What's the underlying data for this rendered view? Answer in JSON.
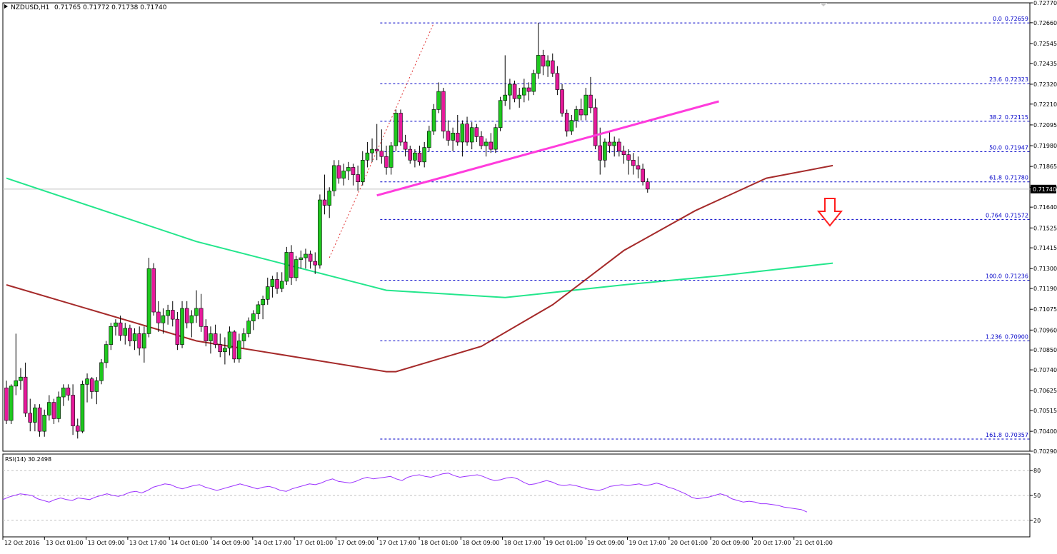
{
  "header": {
    "symbol": "NZDUSD,H1",
    "ohlc": "0.71765 0.71772 0.71738 0.71740"
  },
  "colors": {
    "bull": "#1ec81e",
    "bear": "#e6199b",
    "wick": "#000000",
    "sma_fast": "#a52a2a",
    "sma_slow": "#23e68c",
    "trendline": "#ff3cdc",
    "fib": "#0000c8",
    "arrow": "#ff1e1e",
    "rsi": "#9b30ff",
    "price_tag_bg": "#000000",
    "price_tag_text": "#ffffff"
  },
  "chart_data": [
    {
      "type": "candlestick",
      "title": "NZDUSD,H1",
      "ylim": [
        0.7029,
        0.7277
      ],
      "y_ticks": [
        "0.72770",
        "0.72660",
        "0.72545",
        "0.72435",
        "0.72320",
        "0.72210",
        "0.72095",
        "0.71980",
        "0.71865",
        "0.71750",
        "0.71640",
        "0.71525",
        "0.71415",
        "0.71300",
        "0.71190",
        "0.71075",
        "0.70960",
        "0.70850",
        "0.70740",
        "0.70625",
        "0.70515",
        "0.70400",
        "0.70290"
      ],
      "x_ticks": [
        "12 Oct 2016",
        "13 Oct 01:00",
        "13 Oct 09:00",
        "13 Oct 17:00",
        "14 Oct 01:00",
        "14 Oct 09:00",
        "14 Oct 17:00",
        "17 Oct 01:00",
        "17 Oct 09:00",
        "17 Oct 17:00",
        "18 Oct 01:00",
        "18 Oct 09:00",
        "18 Oct 17:00",
        "19 Oct 01:00",
        "19 Oct 09:00",
        "19 Oct 17:00",
        "20 Oct 01:00",
        "20 Oct 09:00",
        "20 Oct 17:00",
        "21 Oct 01:00"
      ],
      "current_price": "0.71740",
      "fibonacci_levels": [
        {
          "label": "0.0",
          "price": "0.72659"
        },
        {
          "label": "23.6",
          "price": "0.72323"
        },
        {
          "label": "38.2",
          "price": "0.72115"
        },
        {
          "label": "50.0",
          "price": "0.71947"
        },
        {
          "label": "61.8",
          "price": "0.71780"
        },
        {
          "label": "0.764",
          "price": "0.71572"
        },
        {
          "label": "100.0",
          "price": "0.71236"
        },
        {
          "label": "1.236",
          "price": "0.70900"
        },
        {
          "label": "161.8",
          "price": "0.70357"
        }
      ],
      "candles": [
        [
          0.7064,
          0.7068,
          0.7044,
          0.7046
        ],
        [
          0.7046,
          0.7066,
          0.7044,
          0.7065
        ],
        [
          0.7065,
          0.7094,
          0.706,
          0.7068
        ],
        [
          0.7068,
          0.7075,
          0.7063,
          0.707
        ],
        [
          0.707,
          0.7078,
          0.7048,
          0.705
        ],
        [
          0.705,
          0.7058,
          0.704,
          0.7045
        ],
        [
          0.7045,
          0.7055,
          0.704,
          0.7053
        ],
        [
          0.7053,
          0.7055,
          0.7037,
          0.704
        ],
        [
          0.704,
          0.7052,
          0.7037,
          0.7049
        ],
        [
          0.7049,
          0.706,
          0.7046,
          0.7056
        ],
        [
          0.7056,
          0.7058,
          0.7044,
          0.7047
        ],
        [
          0.7047,
          0.7062,
          0.7045,
          0.7059
        ],
        [
          0.7059,
          0.7066,
          0.7054,
          0.7064
        ],
        [
          0.7064,
          0.7066,
          0.7057,
          0.706
        ],
        [
          0.706,
          0.7066,
          0.7038,
          0.7043
        ],
        [
          0.7043,
          0.7047,
          0.7036,
          0.704
        ],
        [
          0.704,
          0.7068,
          0.7039,
          0.7066
        ],
        [
          0.7066,
          0.7072,
          0.7056,
          0.7069
        ],
        [
          0.7069,
          0.707,
          0.7058,
          0.7062
        ],
        [
          0.7062,
          0.707,
          0.7055,
          0.7068
        ],
        [
          0.7068,
          0.708,
          0.7066,
          0.7078
        ],
        [
          0.7078,
          0.709,
          0.7075,
          0.7088
        ],
        [
          0.7088,
          0.71,
          0.7085,
          0.7098
        ],
        [
          0.7098,
          0.7102,
          0.7093,
          0.71
        ],
        [
          0.71,
          0.7104,
          0.709,
          0.7093
        ],
        [
          0.7093,
          0.71,
          0.7088,
          0.7097
        ],
        [
          0.7097,
          0.7099,
          0.7087,
          0.709
        ],
        [
          0.709,
          0.7097,
          0.7085,
          0.7094
        ],
        [
          0.7094,
          0.7098,
          0.7082,
          0.7086
        ],
        [
          0.7086,
          0.7098,
          0.7078,
          0.7094
        ],
        [
          0.7094,
          0.7136,
          0.7092,
          0.713
        ],
        [
          0.713,
          0.7133,
          0.7104,
          0.7106
        ],
        [
          0.7106,
          0.7112,
          0.7095,
          0.71
        ],
        [
          0.71,
          0.7108,
          0.7094,
          0.7104
        ],
        [
          0.7104,
          0.711,
          0.7099,
          0.7107
        ],
        [
          0.7107,
          0.7112,
          0.7098,
          0.7102
        ],
        [
          0.7102,
          0.7106,
          0.7085,
          0.7088
        ],
        [
          0.7088,
          0.7112,
          0.7086,
          0.7108
        ],
        [
          0.7108,
          0.7112,
          0.7097,
          0.71
        ],
        [
          0.71,
          0.7107,
          0.7092,
          0.7104
        ],
        [
          0.7104,
          0.7118,
          0.71,
          0.7108
        ],
        [
          0.7108,
          0.7116,
          0.7095,
          0.7098
        ],
        [
          0.7098,
          0.7102,
          0.7087,
          0.709
        ],
        [
          0.709,
          0.7098,
          0.7083,
          0.7094
        ],
        [
          0.7094,
          0.7099,
          0.7086,
          0.7088
        ],
        [
          0.7088,
          0.7094,
          0.7081,
          0.7084
        ],
        [
          0.7084,
          0.7092,
          0.7077,
          0.7086
        ],
        [
          0.7086,
          0.7098,
          0.7082,
          0.7095
        ],
        [
          0.7095,
          0.7096,
          0.7078,
          0.708
        ],
        [
          0.708,
          0.7094,
          0.7078,
          0.709
        ],
        [
          0.709,
          0.7097,
          0.7086,
          0.7094
        ],
        [
          0.7094,
          0.7103,
          0.7092,
          0.7101
        ],
        [
          0.7101,
          0.7107,
          0.7096,
          0.7105
        ],
        [
          0.7105,
          0.7112,
          0.7102,
          0.711
        ],
        [
          0.711,
          0.7115,
          0.7102,
          0.7113
        ],
        [
          0.7113,
          0.7125,
          0.711,
          0.712
        ],
        [
          0.712,
          0.7126,
          0.7114,
          0.7124
        ],
        [
          0.7124,
          0.7128,
          0.7116,
          0.7119
        ],
        [
          0.7119,
          0.7128,
          0.7117,
          0.7123
        ],
        [
          0.7123,
          0.7142,
          0.7121,
          0.7139
        ],
        [
          0.7139,
          0.7143,
          0.7121,
          0.7125
        ],
        [
          0.7125,
          0.7137,
          0.7123,
          0.7135
        ],
        [
          0.7135,
          0.714,
          0.713,
          0.7136
        ],
        [
          0.7136,
          0.7141,
          0.713,
          0.7138
        ],
        [
          0.7138,
          0.714,
          0.713,
          0.7134
        ],
        [
          0.7134,
          0.7139,
          0.7127,
          0.7132
        ],
        [
          0.7132,
          0.7171,
          0.713,
          0.7168
        ],
        [
          0.7168,
          0.7182,
          0.716,
          0.7165
        ],
        [
          0.7165,
          0.7175,
          0.7158,
          0.7173
        ],
        [
          0.7173,
          0.719,
          0.717,
          0.7187
        ],
        [
          0.7187,
          0.719,
          0.7177,
          0.718
        ],
        [
          0.718,
          0.7188,
          0.7176,
          0.7184
        ],
        [
          0.7184,
          0.7189,
          0.7179,
          0.7186
        ],
        [
          0.7186,
          0.7188,
          0.7176,
          0.7182
        ],
        [
          0.7182,
          0.7187,
          0.7173,
          0.7178
        ],
        [
          0.7178,
          0.7195,
          0.7176,
          0.719
        ],
        [
          0.719,
          0.72,
          0.7186,
          0.7194
        ],
        [
          0.7194,
          0.7202,
          0.7189,
          0.7196
        ],
        [
          0.7196,
          0.721,
          0.719,
          0.7195
        ],
        [
          0.7195,
          0.7207,
          0.7188,
          0.7192
        ],
        [
          0.7192,
          0.7198,
          0.7182,
          0.7186
        ],
        [
          0.7186,
          0.72,
          0.7182,
          0.7198
        ],
        [
          0.7198,
          0.7218,
          0.7195,
          0.7216
        ],
        [
          0.7216,
          0.7218,
          0.7198,
          0.72
        ],
        [
          0.72,
          0.7204,
          0.7192,
          0.7196
        ],
        [
          0.7196,
          0.7198,
          0.7188,
          0.719
        ],
        [
          0.719,
          0.7196,
          0.7186,
          0.7194
        ],
        [
          0.7194,
          0.7198,
          0.7187,
          0.7189
        ],
        [
          0.7189,
          0.72,
          0.7186,
          0.7197
        ],
        [
          0.7197,
          0.7209,
          0.7195,
          0.7206
        ],
        [
          0.7206,
          0.7221,
          0.7204,
          0.7218
        ],
        [
          0.7218,
          0.7233,
          0.7216,
          0.7228
        ],
        [
          0.7228,
          0.723,
          0.7202,
          0.7206
        ],
        [
          0.7206,
          0.7212,
          0.7198,
          0.7201
        ],
        [
          0.7201,
          0.7208,
          0.7195,
          0.7205
        ],
        [
          0.7205,
          0.7215,
          0.7198,
          0.72
        ],
        [
          0.72,
          0.7212,
          0.7192,
          0.721
        ],
        [
          0.721,
          0.7214,
          0.7198,
          0.72
        ],
        [
          0.72,
          0.7211,
          0.7196,
          0.7208
        ],
        [
          0.7208,
          0.721,
          0.72,
          0.7203
        ],
        [
          0.7203,
          0.7206,
          0.7196,
          0.7198
        ],
        [
          0.7198,
          0.7202,
          0.7192,
          0.72
        ],
        [
          0.72,
          0.7205,
          0.7194,
          0.7196
        ],
        [
          0.7196,
          0.721,
          0.7194,
          0.7208
        ],
        [
          0.7208,
          0.7225,
          0.7206,
          0.7223
        ],
        [
          0.7223,
          0.7248,
          0.722,
          0.7226
        ],
        [
          0.7226,
          0.7235,
          0.7218,
          0.7232
        ],
        [
          0.7232,
          0.7234,
          0.7222,
          0.7224
        ],
        [
          0.7224,
          0.723,
          0.7219,
          0.7226
        ],
        [
          0.7226,
          0.7235,
          0.7222,
          0.723
        ],
        [
          0.723,
          0.7233,
          0.7223,
          0.7228
        ],
        [
          0.7228,
          0.724,
          0.7226,
          0.7238
        ],
        [
          0.7238,
          0.7266,
          0.7235,
          0.7248
        ],
        [
          0.7248,
          0.7251,
          0.7237,
          0.7242
        ],
        [
          0.7242,
          0.7248,
          0.7236,
          0.7245
        ],
        [
          0.7245,
          0.7249,
          0.7236,
          0.7238
        ],
        [
          0.7238,
          0.7242,
          0.7226,
          0.7229
        ],
        [
          0.7229,
          0.7232,
          0.7214,
          0.7216
        ],
        [
          0.7216,
          0.7218,
          0.7203,
          0.7206
        ],
        [
          0.7206,
          0.7215,
          0.7204,
          0.7212
        ],
        [
          0.7212,
          0.722,
          0.7208,
          0.7218
        ],
        [
          0.7218,
          0.7224,
          0.7212,
          0.7215
        ],
        [
          0.7215,
          0.723,
          0.7212,
          0.7226
        ],
        [
          0.7226,
          0.7236,
          0.7216,
          0.7219
        ],
        [
          0.7219,
          0.7224,
          0.7196,
          0.7198
        ],
        [
          0.7198,
          0.7208,
          0.7182,
          0.719
        ],
        [
          0.719,
          0.7202,
          0.7186,
          0.72
        ],
        [
          0.72,
          0.7206,
          0.7194,
          0.7198
        ],
        [
          0.7198,
          0.7203,
          0.7192,
          0.72
        ],
        [
          0.72,
          0.7202,
          0.7192,
          0.7195
        ],
        [
          0.7195,
          0.7198,
          0.7188,
          0.7193
        ],
        [
          0.7193,
          0.7196,
          0.7182,
          0.719
        ],
        [
          0.719,
          0.7194,
          0.7182,
          0.7187
        ],
        [
          0.7187,
          0.7192,
          0.718,
          0.7185
        ],
        [
          0.7185,
          0.7188,
          0.7176,
          0.7178
        ],
        [
          0.7178,
          0.718,
          0.7172,
          0.7174
        ]
      ],
      "sma_fast": [
        [
          0,
          0.7121
        ],
        [
          40,
          0.709
        ],
        [
          80,
          0.7073
        ],
        [
          82,
          0.7073
        ],
        [
          100,
          0.7087
        ],
        [
          115,
          0.711
        ],
        [
          130,
          0.714
        ],
        [
          145,
          0.7162
        ],
        [
          160,
          0.718
        ],
        [
          174,
          0.7187
        ]
      ],
      "sma_slow": [
        [
          0,
          0.718
        ],
        [
          40,
          0.7145
        ],
        [
          80,
          0.7118
        ],
        [
          105,
          0.7114
        ],
        [
          130,
          0.7121
        ],
        [
          150,
          0.7126
        ],
        [
          174,
          0.7133
        ]
      ],
      "trendline": {
        "x1": 78,
        "y1": 0.71705,
        "x2": 150,
        "y2": 0.72225
      },
      "fib_ray": {
        "x1": 68,
        "y1": 0.7136,
        "x2": 90,
        "y2": 0.72659
      }
    },
    {
      "type": "line",
      "title": "RSI(14) 30.2498",
      "ylim": [
        0,
        100
      ],
      "y_ticks": [
        "80",
        "50",
        "20"
      ],
      "rsi_values": [
        45,
        48,
        50,
        52,
        51,
        50,
        46,
        44,
        42,
        45,
        47,
        45,
        44,
        47,
        46,
        45,
        48,
        50,
        52,
        50,
        49,
        51,
        54,
        55,
        53,
        56,
        60,
        62,
        64,
        63,
        60,
        58,
        60,
        62,
        63,
        60,
        58,
        56,
        58,
        60,
        62,
        64,
        62,
        60,
        58,
        60,
        61,
        59,
        56,
        55,
        58,
        60,
        62,
        64,
        63,
        65,
        68,
        70,
        67,
        66,
        65,
        67,
        70,
        72,
        70,
        71,
        72,
        73,
        70,
        68,
        72,
        74,
        75,
        73,
        72,
        74,
        76,
        77,
        74,
        72,
        73,
        74,
        75,
        73,
        70,
        68,
        69,
        71,
        72,
        70,
        66,
        63,
        64,
        66,
        68,
        66,
        63,
        62,
        63,
        62,
        60,
        58,
        57,
        56,
        58,
        61,
        62,
        63,
        62,
        63,
        64,
        62,
        63,
        65,
        63,
        60,
        58,
        55,
        52,
        48,
        46,
        47,
        48,
        50,
        52,
        50,
        46,
        44,
        42,
        43,
        42,
        40,
        40,
        39,
        38,
        36,
        35,
        34,
        33,
        30
      ]
    }
  ]
}
